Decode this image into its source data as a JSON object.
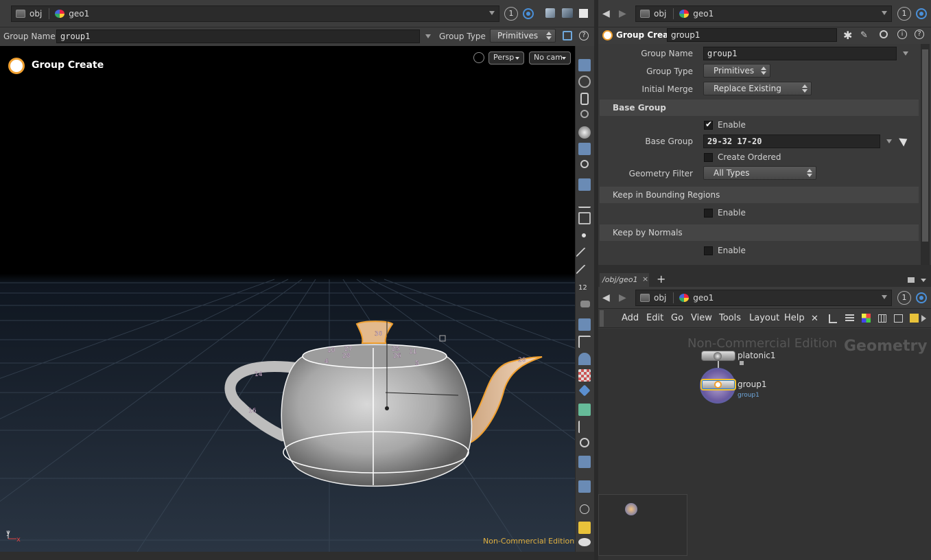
{
  "left_pathbar": {
    "crumbs": [
      "obj",
      "geo1"
    ],
    "count": "1"
  },
  "left_parmbar": {
    "group_name_label": "Group Name",
    "group_name_value": "group1",
    "group_type_label": "Group Type",
    "group_type_value": "Primitives"
  },
  "viewport": {
    "node_title": "Group Create",
    "persp_label": "Persp",
    "cam_label": "No cam",
    "watermark": "Non-Commercial Edition",
    "point_labels": [
      "30",
      "10",
      "27",
      "28",
      "4",
      "25",
      "26",
      "11",
      "5",
      "14",
      "16",
      "20"
    ],
    "axis_y": "y",
    "axis_x": "x"
  },
  "right_pathbar": {
    "crumbs": [
      "obj",
      "geo1"
    ],
    "count": "1"
  },
  "param_editor": {
    "node_type": "Group Create",
    "node_name": "group1",
    "group_name_label": "Group Name",
    "group_name_value": "group1",
    "group_type_label": "Group Type",
    "group_type_value": "Primitives",
    "initial_merge_label": "Initial Merge",
    "initial_merge_value": "Replace Existing",
    "base_group_section": "Base Group",
    "enable_label": "Enable",
    "base_group_label": "Base Group",
    "base_group_value": "29-32 17-20",
    "create_ordered_label": "Create Ordered",
    "geometry_filter_label": "Geometry Filter",
    "geometry_filter_value": "All Types",
    "bounding_section": "Keep in Bounding Regions",
    "bounding_enable": "Enable",
    "normals_section": "Keep by Normals",
    "normals_enable": "Enable"
  },
  "network": {
    "tab_label": "/obj/geo1",
    "tab_close": "×",
    "tab_add": "+",
    "crumbs": [
      "obj",
      "geo1"
    ],
    "count": "1",
    "menu": [
      "Add",
      "Edit",
      "Go",
      "View",
      "Tools",
      "Layout",
      "Help"
    ],
    "watermark_edition": "Non-Commercial Edition",
    "watermark_context": "Geometry",
    "node1_name": "platonic1",
    "node2_name": "group1",
    "node2_sub": "group1"
  }
}
